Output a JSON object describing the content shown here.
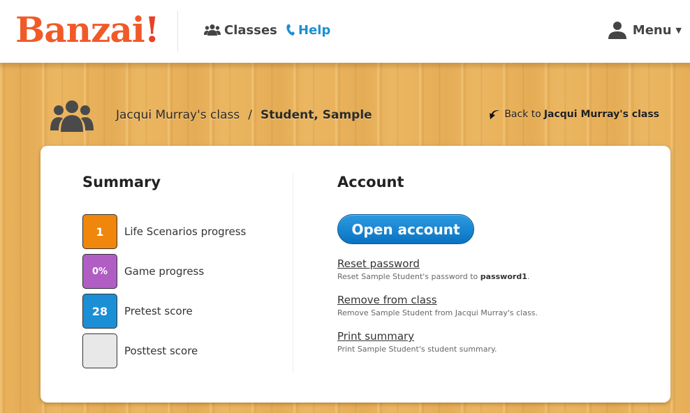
{
  "header": {
    "logo_text": "Banzai",
    "logo_mark": "!",
    "nav": [
      {
        "label": "Classes",
        "icon": "users-icon"
      },
      {
        "label": "Help",
        "icon": "phone-icon"
      }
    ],
    "menu_label": "Menu",
    "menu_caret": "▼"
  },
  "breadcrumb": {
    "parent": "Jacqui Murray's class",
    "separator": "/",
    "current": "Student, Sample",
    "back_prefix": "Back to",
    "back_target": "Jacqui Murray's class"
  },
  "summary": {
    "title": "Summary",
    "stats": [
      {
        "value": "1",
        "label": "Life Scenarios progress",
        "color": "#f0860b"
      },
      {
        "value": "0%",
        "label": "Game progress",
        "color": "#b05ec4"
      },
      {
        "value": "28",
        "label": "Pretest score",
        "color": "#1a8fd5"
      },
      {
        "value": "",
        "label": "Posttest score",
        "color": "#e8e8e8"
      }
    ]
  },
  "account": {
    "title": "Account",
    "open_button": "Open account",
    "actions": [
      {
        "link": "Reset password",
        "desc": "Reset Sample Student's password to ",
        "desc_bold": "password1",
        "desc_tail": "."
      },
      {
        "link": "Remove from class",
        "desc": "Remove Sample Student from Jacqui Murray's class.",
        "desc_bold": "",
        "desc_tail": ""
      },
      {
        "link": "Print summary",
        "desc": "Print Sample Student's student summary.",
        "desc_bold": "",
        "desc_tail": ""
      }
    ]
  },
  "colors": {
    "brand_orange": "#f05a28",
    "link_blue": "#1b8fd1",
    "button_blue": "#0b73c2"
  }
}
